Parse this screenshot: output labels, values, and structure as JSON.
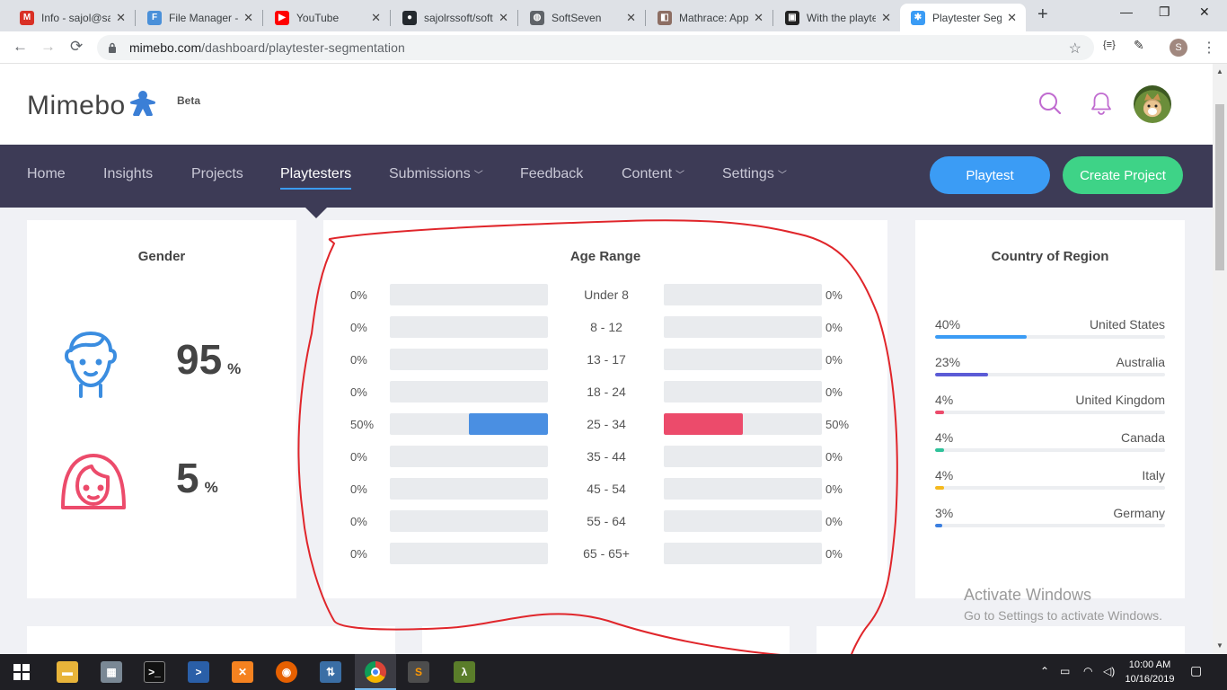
{
  "browser": {
    "tabs": [
      {
        "title": "Info - sajol@sa",
        "icon": "gmail-icon",
        "color": "#d93025",
        "glyph": "M"
      },
      {
        "title": "File Manager - ",
        "icon": "file-manager-icon",
        "color": "#4a90d9",
        "glyph": "F"
      },
      {
        "title": "YouTube",
        "icon": "youtube-icon",
        "color": "#ff0000",
        "glyph": "▶"
      },
      {
        "title": "sajolrssoft/soft",
        "icon": "github-icon",
        "color": "#24292e",
        "glyph": "●"
      },
      {
        "title": "SoftSeven",
        "icon": "globe-icon",
        "color": "#5f6368",
        "glyph": "◍"
      },
      {
        "title": "Mathrace: App",
        "icon": "bucket-icon",
        "color": "#8d6e63",
        "glyph": "◧"
      },
      {
        "title": "With the playte",
        "icon": "app-icon",
        "color": "#222222",
        "glyph": "▣"
      },
      {
        "title": "Playtester Seg",
        "icon": "meeple-icon",
        "color": "#3b9cf5",
        "glyph": "✱"
      }
    ],
    "url_domain": "mimebo.com",
    "url_path": "/dashboard/playtester-segmentation",
    "profile_initial": "S"
  },
  "header": {
    "brand": "Mimebo",
    "beta": "Beta"
  },
  "nav": {
    "items": [
      {
        "label": "Home",
        "dropdown": false
      },
      {
        "label": "Insights",
        "dropdown": false
      },
      {
        "label": "Projects",
        "dropdown": false
      },
      {
        "label": "Playtesters",
        "dropdown": false,
        "active": true
      },
      {
        "label": "Submissions",
        "dropdown": true
      },
      {
        "label": "Feedback",
        "dropdown": false
      },
      {
        "label": "Content",
        "dropdown": true
      },
      {
        "label": "Settings",
        "dropdown": true
      }
    ],
    "playtest_button": "Playtest",
    "create_project_button": "Create Project"
  },
  "gender": {
    "title": "Gender",
    "male_value": "95",
    "male_unit": "%",
    "female_value": "5",
    "female_unit": "%",
    "male_color": "#3b8de0",
    "female_color": "#ec4b6b"
  },
  "age_range": {
    "title": "Age Range",
    "rows": [
      {
        "label": "Under 8",
        "left": "0%",
        "right": "0%",
        "left_value": 0,
        "right_value": 0
      },
      {
        "label": "8 - 12",
        "left": "0%",
        "right": "0%",
        "left_value": 0,
        "right_value": 0
      },
      {
        "label": "13 - 17",
        "left": "0%",
        "right": "0%",
        "left_value": 0,
        "right_value": 0
      },
      {
        "label": "18 - 24",
        "left": "0%",
        "right": "0%",
        "left_value": 0,
        "right_value": 0
      },
      {
        "label": "25 - 34",
        "left": "50%",
        "right": "50%",
        "left_value": 0.5,
        "right_value": 0.5
      },
      {
        "label": "35 - 44",
        "left": "0%",
        "right": "0%",
        "left_value": 0,
        "right_value": 0
      },
      {
        "label": "45 - 54",
        "left": "0%",
        "right": "0%",
        "left_value": 0,
        "right_value": 0
      },
      {
        "label": "55 - 64",
        "left": "0%",
        "right": "0%",
        "left_value": 0,
        "right_value": 0
      },
      {
        "label": "65 - 65+",
        "left": "0%",
        "right": "0%",
        "left_value": 0,
        "right_value": 0
      }
    ]
  },
  "country": {
    "title": "Country of Region",
    "rows": [
      {
        "name": "United States",
        "pct": "40%",
        "value": 0.4,
        "color": "#3b9cf5"
      },
      {
        "name": "Australia",
        "pct": "23%",
        "value": 0.23,
        "color": "#5b5bd6"
      },
      {
        "name": "United Kingdom",
        "pct": "4%",
        "value": 0.04,
        "color": "#ec4b6b"
      },
      {
        "name": "Canada",
        "pct": "4%",
        "value": 0.04,
        "color": "#2fc29a"
      },
      {
        "name": "Italy",
        "pct": "4%",
        "value": 0.04,
        "color": "#f5b91d"
      },
      {
        "name": "Germany",
        "pct": "3%",
        "value": 0.03,
        "color": "#3b7fe0"
      }
    ]
  },
  "watermark": {
    "line1": "Activate Windows",
    "line2": "Go to Settings to activate Windows."
  },
  "taskbar": {
    "time": "10:00 AM",
    "date": "10/16/2019"
  }
}
